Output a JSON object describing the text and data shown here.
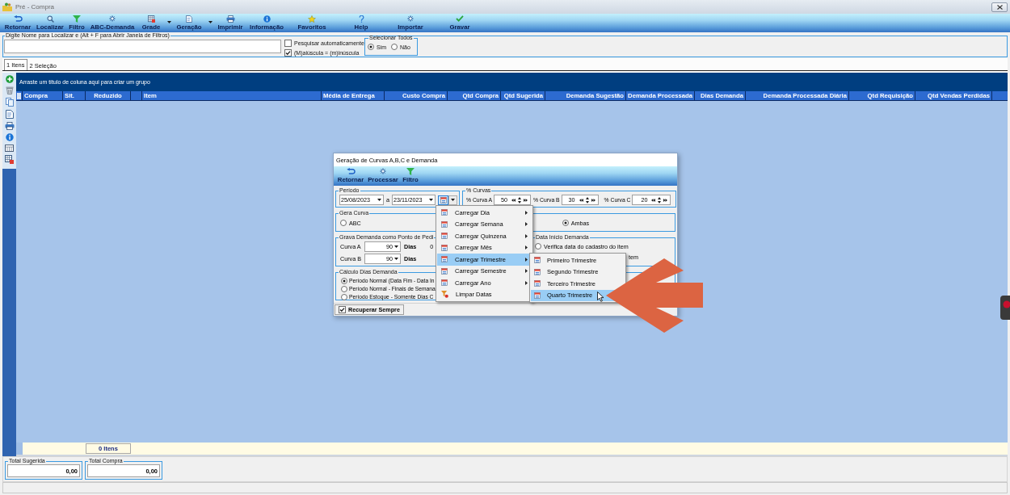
{
  "window": {
    "title": "Pré - Compra"
  },
  "toolbar": [
    {
      "label": "Retornar",
      "dropdown": false
    },
    {
      "label": "Localizar",
      "dropdown": false
    },
    {
      "label": "Filtro",
      "dropdown": false
    },
    {
      "label": "ABC-Demanda",
      "dropdown": false
    },
    {
      "label": "Grade",
      "dropdown": true
    },
    {
      "label": "Geração",
      "dropdown": true
    },
    {
      "label": "Imprimir",
      "dropdown": false
    },
    {
      "label": "Informação",
      "dropdown": false
    },
    {
      "label": "Favoritos",
      "dropdown": false
    },
    {
      "label": "Help",
      "dropdown": false
    },
    {
      "label": "Importar",
      "dropdown": false
    },
    {
      "label": "Gravar",
      "dropdown": false
    }
  ],
  "search": {
    "label": "Digite Nome para Localizar e (Alt + F para Abrir Janela de Filtros)"
  },
  "search_options": [
    {
      "label": "Pesquisar automaticamente",
      "checked": false
    },
    {
      "label": "(M)aiúscula = (m)inúscula",
      "checked": true
    }
  ],
  "select_all": {
    "title": "Selecionar Todos",
    "options": [
      {
        "label": "Sim",
        "selected": true
      },
      {
        "label": "Não",
        "selected": false
      }
    ]
  },
  "tabs": [
    {
      "label": "1 Itens",
      "selected": true
    },
    {
      "label": "2 Seleção",
      "selected": false
    }
  ],
  "grid": {
    "group_hint": "Arraste um título de coluna aqui para criar um grupo",
    "columns": [
      {
        "label": "Compra"
      },
      {
        "label": "Sit."
      },
      {
        "label": "Reduzido",
        "footer": "0 Itens"
      },
      {},
      {
        "label": "Item"
      },
      {
        "label": "Média de Entrega"
      },
      {
        "label": "Custo Compra"
      },
      {
        "label": "Qtd Compra"
      },
      {
        "label": "Qtd Sugerida"
      },
      {
        "label": "Demanda Sugestão"
      },
      {
        "label": "Demanda Processada"
      },
      {
        "label": "Dias Demanda"
      },
      {
        "label": "Demanda Processada Diária"
      },
      {
        "label": "Qtd Requisição"
      },
      {
        "label": "Qtd Vendas Perdidas"
      }
    ]
  },
  "totals": [
    {
      "label": "Total Sugerida",
      "value": "0,00"
    },
    {
      "label": "Total Compra",
      "value": "0,00"
    }
  ],
  "dialog": {
    "title": "Geração de Curvas A,B,C e Demanda",
    "toolbar": [
      {
        "label": "Retornar"
      },
      {
        "label": "Processar"
      },
      {
        "label": "Filtro"
      }
    ],
    "period": {
      "title": "Período",
      "from": "25/08/2023",
      "separator": "a",
      "to": "23/11/2023",
      "menu_open": true
    },
    "curves": {
      "title": "% Curvas",
      "items": [
        {
          "label": "% Curva A",
          "value": "50"
        },
        {
          "label": "% Curva B",
          "value": "30"
        },
        {
          "label": "% Curva C",
          "value": "20"
        }
      ]
    },
    "generate": {
      "title": "Gera Curva",
      "options": [
        {
          "label": "ABC",
          "selected": false
        },
        {
          "label": "Ambas",
          "selected": true
        }
      ]
    },
    "reorder_point": {
      "title": "Grava Demanda como Ponto de Pedi",
      "rows": [
        {
          "label": "Curva A",
          "value": "90",
          "unit": "Dias",
          "cut_text": "0"
        },
        {
          "label": "Curva B",
          "value": "90",
          "unit": "Dias"
        }
      ]
    },
    "start_date": {
      "title": "Data Início Demanda",
      "options": [
        {
          "label": "Verifica data do cadastro do item",
          "selected": false
        }
      ],
      "cut_text": "tem"
    },
    "days_calc": {
      "title": "Cálculo Dias Demanda",
      "options": [
        {
          "label": "Período Normal (Data Fim - Data In",
          "selected": true
        },
        {
          "label": "Período Normal - Finais de Semana",
          "selected": false
        },
        {
          "label": "Período Estoque - Somente Dias C",
          "selected": false
        }
      ]
    },
    "always_recover": {
      "label": "Recuperar Sempre",
      "checked": true
    },
    "menu": [
      {
        "label": "Carregar Dia",
        "kind": "load",
        "submenu": true,
        "selected": false
      },
      {
        "label": "Carregar Semana",
        "kind": "load",
        "submenu": true,
        "selected": false
      },
      {
        "label": "Carregar Quinzena",
        "kind": "load",
        "submenu": true,
        "selected": false
      },
      {
        "label": "Carregar Mês",
        "kind": "load",
        "submenu": true,
        "selected": false
      },
      {
        "label": "Carregar Trimestre",
        "kind": "load",
        "submenu": true,
        "selected": true
      },
      {
        "label": "Carregar Semestre",
        "kind": "load",
        "submenu": true,
        "selected": false
      },
      {
        "label": "Carregar Ano",
        "kind": "load",
        "submenu": true,
        "selected": false
      },
      {
        "label": "Limpar Datas",
        "kind": "clear",
        "submenu": false,
        "selected": false
      }
    ],
    "submenu": [
      {
        "label": "Primeiro Trimestre",
        "selected": false
      },
      {
        "label": "Segundo Trimestre",
        "selected": false
      },
      {
        "label": "Terceiro Trimestre",
        "selected": false
      },
      {
        "label": "Quarto Trimestre",
        "selected": true
      }
    ]
  }
}
